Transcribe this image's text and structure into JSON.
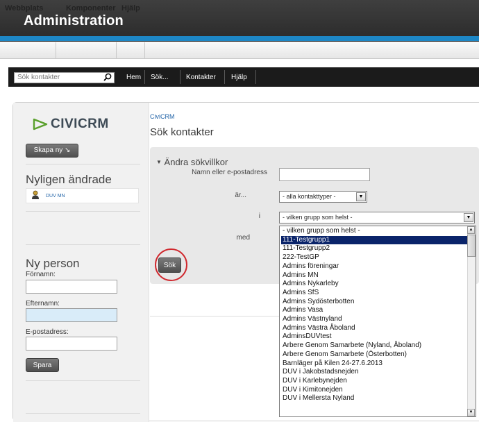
{
  "admin": {
    "title": "Administration",
    "menu": [
      "Webbplats",
      "Komponenter",
      "Hjälp"
    ]
  },
  "civi_nav": {
    "search_placeholder": "Sök kontakter",
    "items": [
      "Hem",
      "Sök...",
      "Kontakter",
      "Hjälp"
    ]
  },
  "sidebar": {
    "logo_text": "CIVICRM",
    "create_new": "Skapa ny ↘",
    "recent_title": "Nyligen ändrade",
    "recent_items": [
      "DUV MN"
    ],
    "new_person_title": "Ny person",
    "first_name_label": "Förnamn:",
    "last_name_label": "Efternamn:",
    "email_label": "E-postadress:",
    "save_label": "Spara"
  },
  "main": {
    "breadcrumb": "CiviCRM",
    "title": "Sök kontakter",
    "criteria_toggle": "Ändra sökvillkor",
    "name_label": "Namn eller e-postadress",
    "is_label": "är...",
    "in_label": "i",
    "with_label": "med",
    "contact_type_value": "- alla kontakttyper -",
    "group_value": "- vilken grupp som helst -",
    "search_label": "Sök"
  },
  "group_options": [
    "- vilken grupp som helst -",
    "111-Testgrupp1",
    "111-Testgrupp2",
    "222-TestGP",
    "Admins föreningar",
    "Admins MN",
    "Admins Nykarleby",
    "Admins SfS",
    "Admins Sydösterbotten",
    "Admins Vasa",
    "Admins Västnyland",
    "Admins Västra Åboland",
    "AdminsDUVtest",
    "Arbere Genom Samarbete (Nyland, Åboland)",
    "Arbere Genom Samarbete (Österbotten)",
    "Barnläger på Kilen 24-27.6.2013",
    "DUV i Jakobstadsnejden",
    "DUV i Karlebynejden",
    "DUV i Kimitonejden",
    "DUV i Mellersta Nyland"
  ],
  "selected_group_index": 1,
  "colors": {
    "accent_blue": "#1d87c6",
    "link_blue": "#2264a8",
    "highlight_red": "#d0282e",
    "selection_navy": "#0a246a",
    "logo_green": "#5aa02c"
  }
}
